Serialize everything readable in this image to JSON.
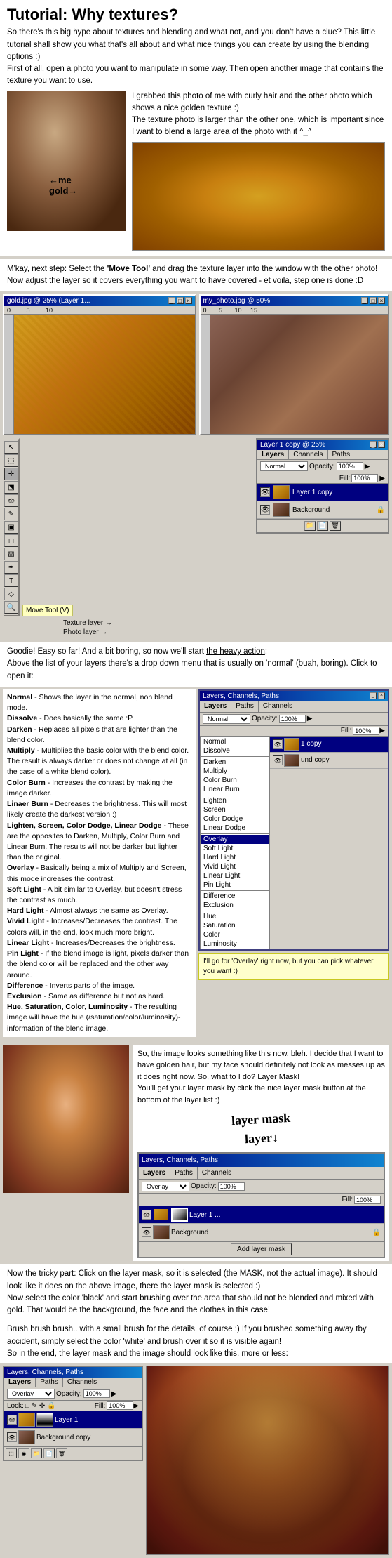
{
  "tutorial": {
    "title": "Tutorial: Why textures?",
    "intro": "So there's this big hype about textures and blending and what not, and you don't have a clue? This little tutorial shall show you what that's all about and what nice things you can create by using the blending options :)\nFirst of all, open a photo you want to manipulate in some way. Then open another image that contains the texture you want to use.",
    "grabbed_text": "I grabbed this photo of me with curly hair and the other photo which shows a nice golden texture :)\nThe texture photo is larger than the other one, which is important since I want to blend a large area of the photo with it ^_^",
    "me_annotation": "←me",
    "gold_annotation": "gold→",
    "step2_text": "M'kay, next step: Select the 'Move Tool' and drag the texture layer into the window with the other photo!\nNow adjust the layer so it covers everything you want to have covered - et voila, step one is done :D",
    "move_tool_label": "Move Tool (V)",
    "texture_layer_label": "Texture layer →",
    "photo_layer_label": "Photo layer →",
    "layer1_copy": "Layer 1 copy",
    "background": "Background",
    "goodie_text": "Goodie! Easy so far! And a bit boring, so now we'll start the heavy action:\nAbove the list of your layers there's a drop down menu that is usually on 'normal' (buah, boring). Click to open it:",
    "blend_modes": {
      "normal": "Normal",
      "dissolve": "Dissolve",
      "darken": "Darken",
      "multiply": "Multiply",
      "color_burn": "Color Burn",
      "linear_burn": "Linear Burn",
      "lighten": "Lighten",
      "screen": "Screen",
      "color_dodge": "Color Dodge",
      "linear_dodge": "Linear Dodge",
      "overlay": "Overlay",
      "soft_light": "Soft Light",
      "hard_light": "Hard Light",
      "vivid_light": "Vivid Light",
      "linear_light": "Linear Light",
      "pin_light": "Pin Light",
      "difference": "Difference",
      "exclusion": "Exclusion",
      "hue": "Hue",
      "saturation": "Saturation",
      "color": "Color",
      "luminosity": "Luminosity"
    },
    "blend_descriptions": {
      "normal": "Normal - Shows the layer in the normal, non blend mode.",
      "dissolve": "Dissolve - Does basically the same :P",
      "darken": "Darken - Replaces all pixels that are lighter than the blend color.",
      "multiply": "Multiply - Multiplies the basic color with the blend color. The result is always darker or does not change at all (in the case of a white blend color).",
      "color_burn": "Color Burn - Increases the contrast by making the image darker.",
      "linear_burn": "Linaer Burn - Decreases the brightness. This will most likely create the darkest version :)",
      "lighten_group": "Lighten, Screen, Color Dodge, Linear Dodge - These are the opposites to Darken, Multiply, Color Burn and Linear Burn. The results will not be darker but lighter than the original.",
      "overlay": "Overlay - Basically being a mix of Multiply and Screen, this mode increases the contrast.",
      "soft_light": "Soft Light - A bit similar to Overlay, but doesn't stress the contrast as much.",
      "hard_light": "Hard Light - Almost always the same as Overlay.",
      "vivid_light": "Vivid Light - Increases/Decreases the contrast. The colors will, in the end, look much more bright.",
      "linear_light": "Linear Light - Increases/Decreases the brightness.",
      "pin_light": "Pin Light - If the blend image is light, pixels darker than the blend color will be replaced and the other way around.",
      "difference": "Difference - Inverts parts of the image.",
      "exclusion": "Exclusion - Same as difference but not as hard.",
      "hue_sat": "Hue, Saturation, Color, Luminosity - The resulting image will have the hue (/saturation/color/luminosity)-information of the blend image."
    },
    "overlay_note": "I'll go for 'Overlay' right now, but you can pick whatever you want :)",
    "layer_mask_text": {
      "intro": "So, the image looks something like this now, bleh. I decide that I want to have golden hair, but my face should definitely not look as messes up as it does right now. So, what to I do? Layer Mask!\nYou'll get your layer mask by click the nice layer mask button at the bottom of the layer list :)",
      "handwriting": "layer mask\nlayer↓",
      "layer1_label": "Layer 1 ...",
      "background_label": "Background",
      "add_layer_mask": "Add layer mask",
      "tricky_part": "Now the tricky part: Click on the layer mask, so it is selected (the MASK, not the actual image). It should look like it does on the above image, there the layer mask is selected :)\nNow select the color 'black' and start brushing over the area that should not be blended and mixed with gold. That would be the background, the face and the clothes in this case!",
      "brush_text": "Brush brush brush.. with a small brush for the details, of course :) If you brushed something away tby accident, simply select the color 'white' and brush over it so it is visible again!\nSo in the end, the layer mask and the image should look like this, more or less:"
    },
    "final_layers": {
      "mode": "Overlay",
      "opacity": "100%",
      "fill": "100%",
      "lock_label": "Lock:",
      "layer1": "Layer 1",
      "background_copy": "Background copy"
    },
    "panels": {
      "layers_label": "Layers",
      "channels_label": "Channels",
      "paths_label": "Paths",
      "opacity_label": "Opacity:",
      "fill_label": "Fill:",
      "opacity_value": "100%",
      "fill_value": "100%",
      "normal_label": "Normal",
      "dissolve_label": "Dissolve"
    }
  }
}
